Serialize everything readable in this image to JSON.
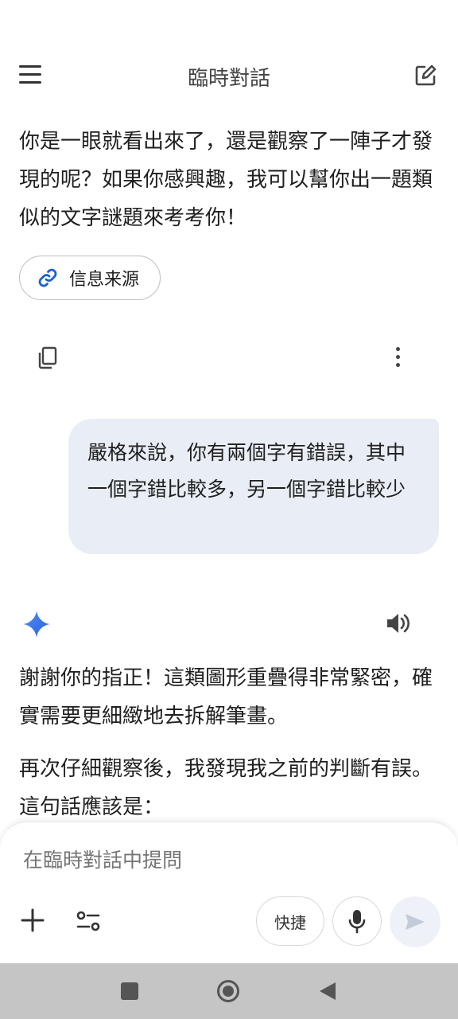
{
  "header": {
    "title": "臨時對話",
    "menu_icon": "menu-icon",
    "edit_icon": "edit-icon"
  },
  "conversation": {
    "ai_prev_text": "你是一眼就看出來了，還是觀察了一陣子才發現的呢？如果你感興趣，我可以幫你出一題類似的文字謎題來考考你！",
    "sources_label": "信息来源",
    "user_message": "嚴格來說，你有兩個字有錯誤，其中一個字錯比較多，另一個字錯比較少",
    "ai_reply_p1": "謝謝你的指正！這類圖形重疊得非常緊密，確實需要更細緻地去拆解筆畫。",
    "ai_reply_p2": "再次仔細觀察後，我發現我之前的判斷有誤。這句話應該是："
  },
  "composer": {
    "placeholder": "在臨時對話中提問",
    "quick_label": "快捷"
  },
  "colors": {
    "user_bubble": "#e9eef6",
    "gemini_blue": "#3b7ae8",
    "link_blue": "#1a5fd1",
    "navbar": "#c5c5c5"
  }
}
